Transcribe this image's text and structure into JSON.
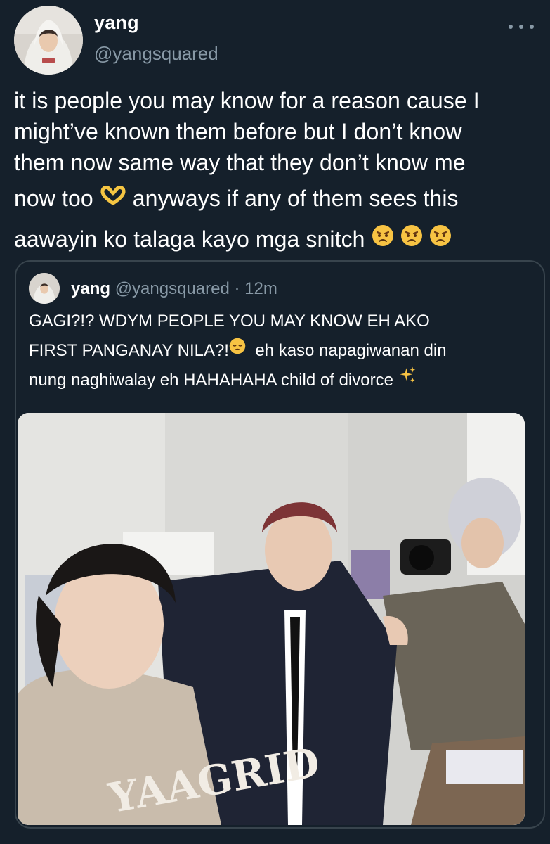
{
  "tweet": {
    "display_name": "yang",
    "handle": "@yangsquared",
    "more_icon": "more-horizontal-icon",
    "text_lines": [
      "it is people you may know for a reason cause I",
      "might’ve known them before but I don’t know",
      "them now same way that they don’t know me",
      "now too",
      "anyways if any of them sees this",
      "aawayin ko talaga kayo mga snitch"
    ],
    "emojis": [
      "heart-hands-emoji",
      "angry-face-emoji"
    ]
  },
  "quoted_tweet": {
    "display_name": "yang",
    "handle": "@yangsquared",
    "separator": "·",
    "time": "12m",
    "text_lines": [
      "GAGI?!? WDYM PEOPLE YOU MAY KNOW EH AKO",
      "FIRST PANGANAY NILA?!",
      "eh kaso napagiwanan din",
      "nung naghiwalay eh HAHAHAHA child of divorce"
    ],
    "emojis": [
      "pensive-face-emoji",
      "sparkles-emoji"
    ],
    "photo": {
      "description_icon": "group-selfie-photo",
      "sweater_text": "YAAGRID"
    }
  },
  "colors": {
    "background": "#15202b",
    "text": "#ffffff",
    "secondary_text": "#8899a6",
    "border": "#38444d"
  }
}
